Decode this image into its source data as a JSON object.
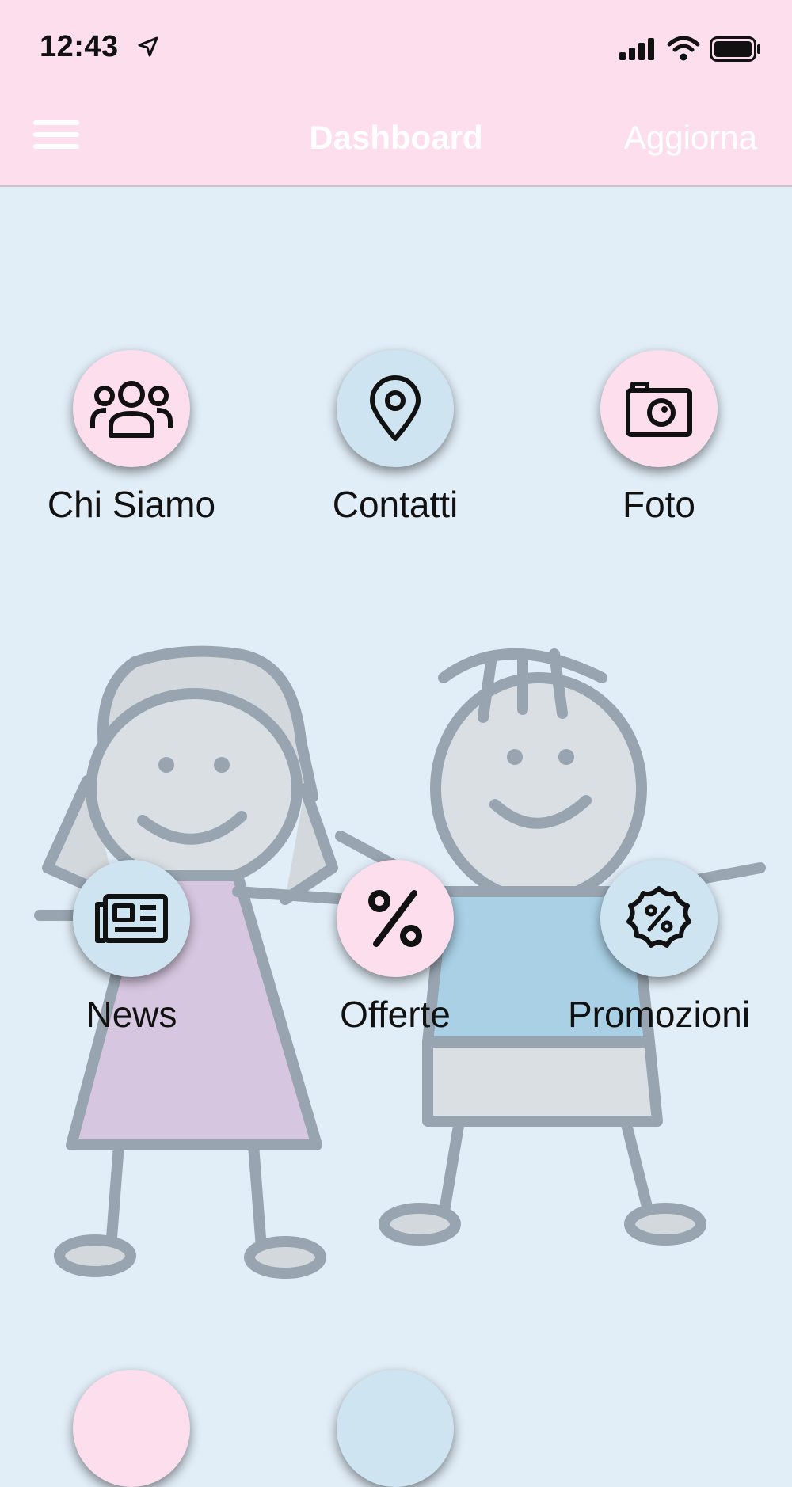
{
  "status": {
    "time": "12:43"
  },
  "nav": {
    "title": "Dashboard",
    "action": "Aggiorna"
  },
  "tiles": [
    {
      "label": "Chi Siamo",
      "icon": "group-icon",
      "color": "#fcdeec"
    },
    {
      "label": "Contatti",
      "icon": "location-pin-icon",
      "color": "#cfe4f1"
    },
    {
      "label": "Foto",
      "icon": "camera-icon",
      "color": "#fcdeec"
    },
    {
      "label": "News",
      "icon": "newspaper-icon",
      "color": "#cfe4f1"
    },
    {
      "label": "Offerte",
      "icon": "percent-icon",
      "color": "#fcdeec"
    },
    {
      "label": "Promozioni",
      "icon": "discount-badge-icon",
      "color": "#cfe4f1"
    }
  ],
  "colors": {
    "header": "#fcdeec",
    "background": "#e1edf7"
  }
}
